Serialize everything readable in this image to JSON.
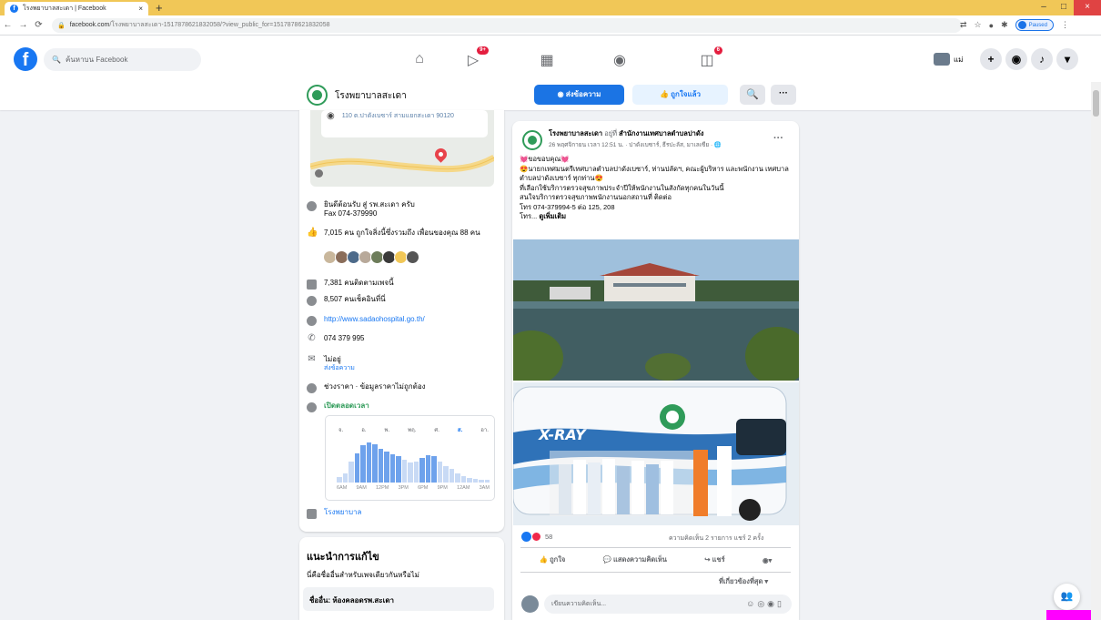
{
  "browser": {
    "tab_title": "โรงพยาบาลสะเดา | Facebook",
    "tab_close": "×",
    "new_tab": "+",
    "url_host": "facebook.com",
    "url_path": "/โรงพยาบาลสะเดา-1517878621832058/?view_public_for=1517878621832058",
    "profile_status": "Paused",
    "window_controls": [
      "–",
      "□",
      "×"
    ]
  },
  "facebook": {
    "logo": "f",
    "search_placeholder": "ค้นหาบน Facebook",
    "nav_badges": {
      "watch": "9+",
      "notifications": "6"
    },
    "profile_name": "แม่"
  },
  "page_header": {
    "name": "โรงพยาบาลสะเดา",
    "message_button": "ส่งข้อความ",
    "liked_button": "ถูกใจแล้ว",
    "search_button": "🔍",
    "more_button": "···"
  },
  "about": {
    "address": "110 ต.ปาดังเบซาร์ สามแยกสะเดา 90120",
    "rows": [
      {
        "key": "intro",
        "line1": "ยินดีต้อนรับ สู่ รพ.สะเดา ครับ",
        "line2": "Fax 074-379990"
      },
      {
        "key": "likes",
        "line1": "7,015 คน ถูกใจสิ่งนี้ซึ่งรวมถึง เพื่อนของคุณ 88 คน"
      },
      {
        "key": "follows",
        "line1": "7,381 คนติดตามเพจนี้"
      },
      {
        "key": "checkins",
        "line1": "8,507 คนเช็คอินที่นี่"
      },
      {
        "key": "website",
        "line1": "http://www.sadaohospital.go.th/"
      },
      {
        "key": "phone",
        "line1": "074 379 995"
      },
      {
        "key": "reply",
        "line1": "ไม่อยู่",
        "line2": "ส่งข้อความ"
      },
      {
        "key": "price",
        "line1": "ช่วงราคา · ข้อมูลราคาไม่ถูกต้อง"
      },
      {
        "key": "hours",
        "line1": "เปิดตลอดเวลา"
      },
      {
        "key": "category",
        "line1": "โรงพยาบาล"
      }
    ],
    "hours_chart": {
      "days": [
        "จ.",
        "อ.",
        "พ.",
        "พฤ.",
        "ศ.",
        "ส.",
        "อา."
      ],
      "selected_day": "ส.",
      "hour_labels": [
        "6AM",
        "9AM",
        "12PM",
        "3PM",
        "6PM",
        "9PM",
        "12AM",
        "3AM"
      ],
      "busyness": [
        0.12,
        0.2,
        0.45,
        0.62,
        0.78,
        0.85,
        0.8,
        0.72,
        0.65,
        0.6,
        0.55,
        0.48,
        0.42,
        0.45,
        0.52,
        0.58,
        0.55,
        0.45,
        0.35,
        0.28,
        0.2,
        0.14,
        0.1,
        0.08,
        0.06,
        0.05
      ]
    }
  },
  "suggest": {
    "title": "แนะนำการแก้ไข",
    "question": "นี่คือชื่ออื่นสำหรับเพจเดียวกันหรือไม่",
    "alt_name": "ชื่ออื่น: ห้องคลอดรพ.สะเดา"
  },
  "post": {
    "author": "โรงพยาบาลสะเดา",
    "at_word": "อยู่ที่",
    "location": "สำนักงานเทศบาลตำบลปาดัง",
    "meta": "26 พฤศจิกายน เวลา 12:51 น. · ปาดังเบซาร์, ธีรปะลัส, มาเลเซีย · 🌐",
    "lines": [
      "💓ขอขอบคุณ💓",
      "😍นายกเทศมนตรีเทศบาลตำบลปาดังเบซาร์, ท่านปลัดฯ, คณะผู้บริหาร และพนักงาน เทศบาลตำบลปาดังเบซาร์ ทุกท่าน😍",
      "ที่เลือกใช้บริการตรวจสุขภาพประจำปีให้พนักงานในสังกัดทุกคนในวันนี้",
      "สนใจบริการตรวจสุขภาพพนักงานนอกสถานที่ ติดต่อ",
      "โทร 074-379994-5 ต่อ 125, 208"
    ],
    "tail": "โทร...",
    "see_more": "ดูเพิ่มเติม",
    "reaction_count": "58",
    "stats": "ความคิดเห็น 2 รายการ แชร์ 2 ครั้ง",
    "actions": [
      "ถูกใจ",
      "แสดงความคิดเห็น",
      "แชร์"
    ],
    "relevant": "ที่เกี่ยวข้องที่สุด ▾",
    "comment_placeholder": "เขียนความคิดเห็น...",
    "bus_sign": "X-RAY"
  },
  "colors": {
    "fb_blue": "#1877f2",
    "hospital_green": "#2f9b59",
    "tab_bar": "#f1c757"
  }
}
